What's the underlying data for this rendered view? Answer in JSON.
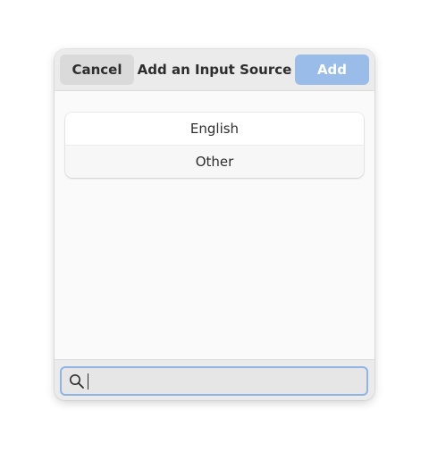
{
  "dialog": {
    "title": "Add an Input Source",
    "cancel_label": "Cancel",
    "add_label": "Add",
    "add_enabled": false
  },
  "list": {
    "items": [
      {
        "label": "English"
      },
      {
        "label": "Other"
      }
    ]
  },
  "search": {
    "value": "",
    "icon": "search-icon"
  },
  "colors": {
    "accent": "#99bce9",
    "focus_border": "#90b4e3",
    "headerbar": "#ebebeb",
    "background": "#fafafa"
  }
}
